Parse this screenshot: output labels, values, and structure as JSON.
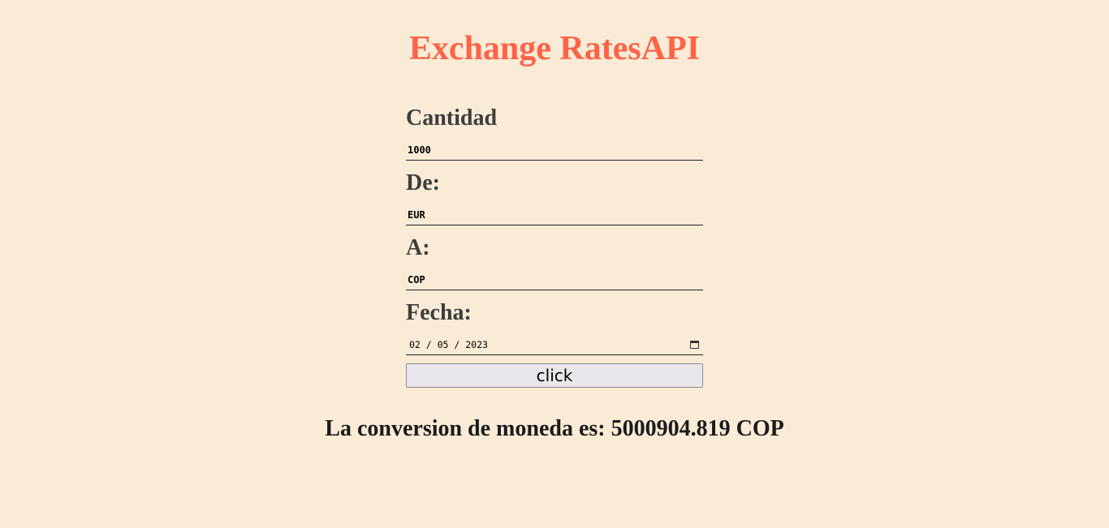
{
  "header": {
    "title": "Exchange RatesAPI"
  },
  "form": {
    "amount": {
      "label": "Cantidad",
      "value": "1000"
    },
    "from": {
      "label": "De:",
      "value": "EUR"
    },
    "to": {
      "label": "A:",
      "value": "COP"
    },
    "date": {
      "label": "Fecha:",
      "value": "02 / 05 / 2023",
      "icon": "calendar-icon"
    },
    "submit_label": "click"
  },
  "result": {
    "text": "La conversion de moneda es: 5000904.819 COP"
  },
  "colors": {
    "background": "#faebd7",
    "title": "#ff6347",
    "label": "#3d3d3d",
    "button_bg": "#e9e7ec"
  }
}
